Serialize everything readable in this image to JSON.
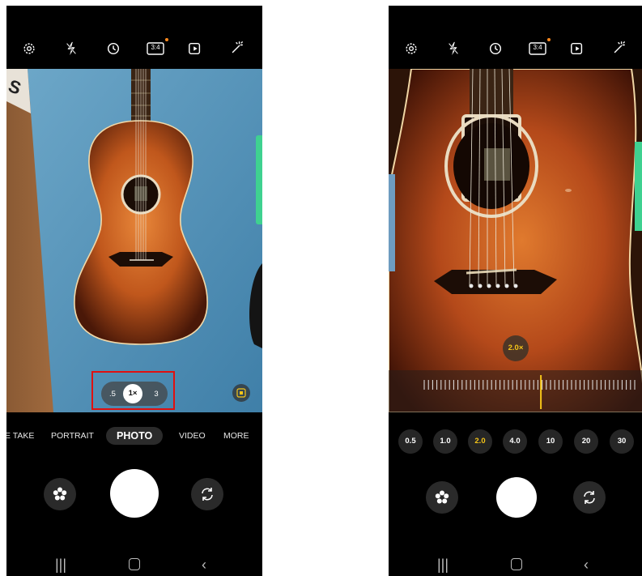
{
  "accent_color": "#f5c518",
  "highlight_color": "#e01010",
  "top_icons": [
    "settings-icon",
    "flash-off-icon",
    "timer-icon",
    "aspect-ratio-icon",
    "motion-photo-icon",
    "effects-icon"
  ],
  "aspect_ratio_label": "3:4",
  "left": {
    "zoom_options": [
      ".5",
      "1×",
      "3"
    ],
    "selected_zoom": "1×",
    "modes": [
      "E TAKE",
      "PORTRAIT",
      "PHOTO",
      "VIDEO",
      "MORE"
    ],
    "active_mode": "PHOTO"
  },
  "right": {
    "zoom_badge": "2.0×",
    "zoom_chips": [
      "0.5",
      "1.0",
      "2.0",
      "4.0",
      "10",
      "20",
      "30"
    ],
    "active_chip": "2.0",
    "zoom_slider_position": 0.55
  },
  "controls": [
    "effects-button",
    "shutter-button",
    "switch-camera-button"
  ],
  "nav": [
    "recent-apps-icon",
    "home-icon",
    "back-icon"
  ]
}
